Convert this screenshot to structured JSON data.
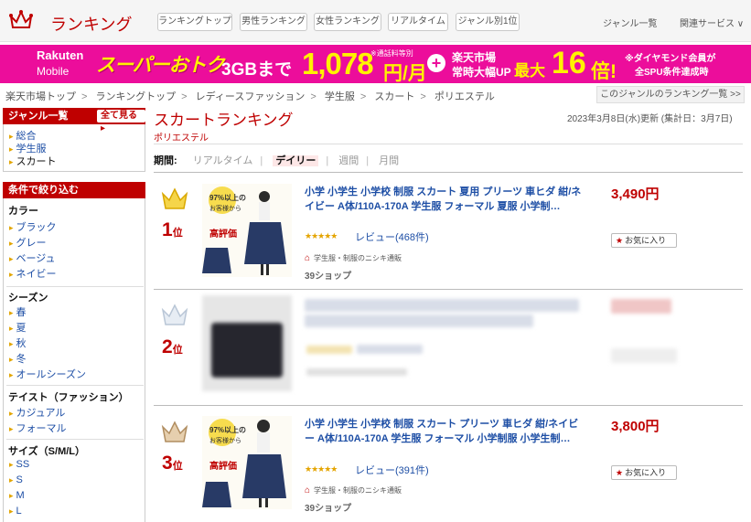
{
  "header": {
    "title": "ランキング",
    "tabs": [
      "ランキングトップ",
      "男性ランキング",
      "女性ランキング",
      "リアルタイム",
      "ジャンル別1位"
    ],
    "genre_list": "ジャンル一覧",
    "related": "関連サービス ∨"
  },
  "banner": {
    "rakuten": "Rakuten",
    "mobile": "Mobile",
    "super": "スーパーおトク",
    "gb": "3GBまで",
    "price": "1,078",
    "yen": "円/月",
    "note1": "※通話料等別",
    "plus": "+",
    "market1": "楽天市場",
    "market2": "常時大幅UP",
    "max": "最大",
    "times": "16",
    "bai": "倍!",
    "note2": "※ダイヤモンド会員が",
    "note3": "全SPU条件達成時"
  },
  "breadcrumb": [
    "楽天市場トップ",
    "ランキングトップ",
    "レディースファッション",
    "学生服",
    "スカート",
    "ポリエステル"
  ],
  "genre_ranking_link": "このジャンルのランキング一覧 >>",
  "sidebar": {
    "genre_head": "ジャンル一覧",
    "all_label": "全て見る",
    "genres": [
      "総合",
      "学生服",
      "スカート"
    ],
    "filter_head": "条件で絞り込む",
    "sections": [
      {
        "title": "カラー",
        "items": [
          "ブラック",
          "グレー",
          "ベージュ",
          "ネイビー"
        ]
      },
      {
        "title": "シーズン",
        "items": [
          "春",
          "夏",
          "秋",
          "冬",
          "オールシーズン"
        ]
      },
      {
        "title": "テイスト（ファッション）",
        "items": [
          "カジュアル",
          "フォーマル"
        ]
      },
      {
        "title": "サイズ（S/M/L）",
        "items": [
          "SS",
          "S",
          "M",
          "L"
        ]
      }
    ]
  },
  "main": {
    "title": "スカートランキング",
    "subgenre": "ポリエステル",
    "updated": "2023年3月8日(水)更新 (集計日：3月7日)",
    "period_label": "期間:",
    "periods": [
      "リアルタイム",
      "デイリー",
      "週間",
      "月間"
    ],
    "selected_period": "デイリー"
  },
  "items": [
    {
      "rank": "1",
      "rank_suffix": "位",
      "title": "小学 小学生 小学校 制服 スカート 夏用 プリーツ 車ヒダ 紺/ネイビー A体/110A-170A 学生服 フォーマル 夏服 小学制…",
      "price": "3,490円",
      "stars": "★★★★★",
      "review": "レビュー(468件)",
      "shop": "学生服・制服のニシキ通販",
      "badge": "39ショップ",
      "fav": "お気に入り",
      "thumb_pct": "97%以上の",
      "thumb_text1": "お客様から",
      "thumb_text2": "高評価"
    },
    {
      "rank": "2",
      "rank_suffix": "位"
    },
    {
      "rank": "3",
      "rank_suffix": "位",
      "title": "小学 小学生 小学校 制服 スカート プリーツ 車ヒダ 紺/ネイビー A体/110A-170A 学生服 フォーマル 小学制服 小学生制…",
      "price": "3,800円",
      "stars": "★★★★★",
      "review": "レビュー(391件)",
      "shop": "学生服・制服のニシキ通販",
      "badge": "39ショップ",
      "fav": "お気に入り",
      "thumb_pct": "97%以上の",
      "thumb_text1": "お客様から",
      "thumb_text2": "高評価"
    }
  ],
  "colors": {
    "brand": "#bf0000",
    "banner": "#ec0d9b",
    "gold": "#e2b100",
    "silver": "#b9c6d6",
    "bronze": "#b08d60"
  }
}
